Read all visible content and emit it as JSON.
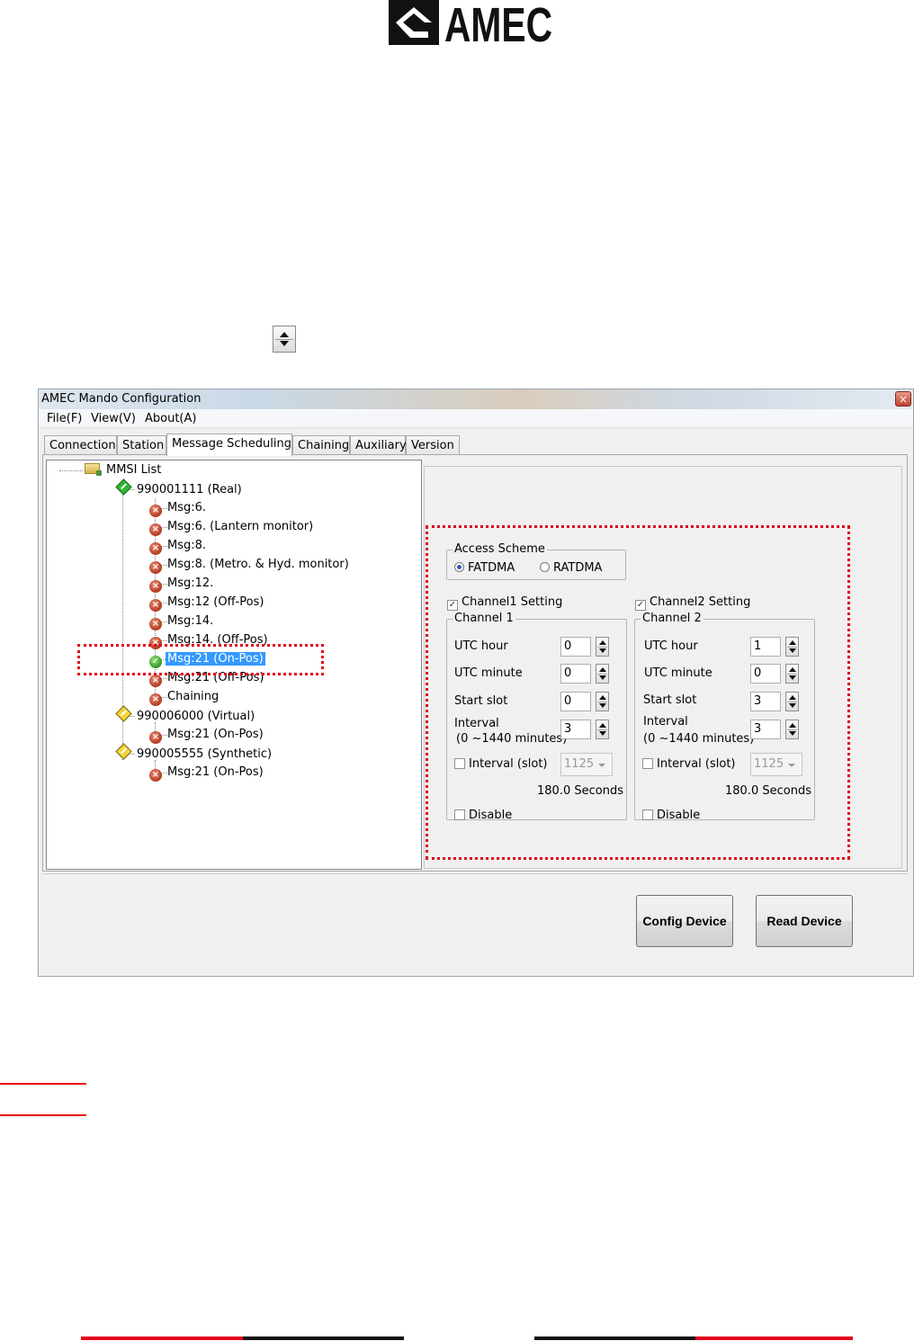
{
  "logo": {
    "text": "AMEC"
  },
  "window": {
    "title": "AMEC Mando Configuration",
    "close_glyph": "×"
  },
  "menu": [
    "File(F)",
    "View(V)",
    "About(A)"
  ],
  "tabs": [
    "Connection",
    "Station",
    "Message Scheduling",
    "Chaining",
    "Auxiliary",
    "Version"
  ],
  "active_tab": "Message Scheduling",
  "tree": {
    "root": "MMSI List",
    "items": [
      {
        "label": "990001111  (Real)"
      },
      {
        "label": "Msg:6."
      },
      {
        "label": "Msg:6. (Lantern monitor)"
      },
      {
        "label": "Msg:8."
      },
      {
        "label": "Msg:8. (Metro. & Hyd. monitor)"
      },
      {
        "label": "Msg:12."
      },
      {
        "label": "Msg:12  (Off-Pos)"
      },
      {
        "label": "Msg:14."
      },
      {
        "label": "Msg:14. (Off-Pos)"
      },
      {
        "label": "Msg:21  (On-Pos)"
      },
      {
        "label": "Msg:21  (Off-Pos)"
      },
      {
        "label": "Chaining"
      },
      {
        "label": "990006000  (Virtual)"
      },
      {
        "label": "Msg:21  (On-Pos)"
      },
      {
        "label": "990005555  (Synthetic)"
      },
      {
        "label": "Msg:21  (On-Pos)"
      }
    ]
  },
  "access_scheme": {
    "title": "Access Scheme",
    "options": [
      "FATDMA",
      "RATDMA"
    ],
    "selected": "FATDMA"
  },
  "channel1": {
    "setting_label": "Channel1 Setting",
    "group_title": "Channel 1",
    "utc_hour_label": "UTC hour",
    "utc_hour": "0",
    "utc_minute_label": "UTC minute",
    "utc_minute": "0",
    "start_slot_label": "Start slot",
    "start_slot": "0",
    "interval_label": "Interval",
    "interval_range": "(0 ~1440 minutes)",
    "interval": "3",
    "interval_slot_label": "Interval (slot)",
    "interval_slot": "1125",
    "seconds": "180.0 Seconds",
    "disable_label": "Disable"
  },
  "channel2": {
    "setting_label": "Channel2 Setting",
    "group_title": "Channel 2",
    "utc_hour_label": "UTC hour",
    "utc_hour": "1",
    "utc_minute_label": "UTC minute",
    "utc_minute": "0",
    "start_slot_label": "Start slot",
    "start_slot": "3",
    "interval_label": "Interval",
    "interval_range": "(0 ~1440 minutes)",
    "interval": "3",
    "interval_slot_label": "Interval (slot)",
    "interval_slot": "1125",
    "seconds": "180.0 Seconds",
    "disable_label": "Disable"
  },
  "buttons": {
    "config": "Config Device",
    "read": "Read Device"
  },
  "colors": {
    "highlight": "#e0001b",
    "selection": "#3399ff"
  }
}
